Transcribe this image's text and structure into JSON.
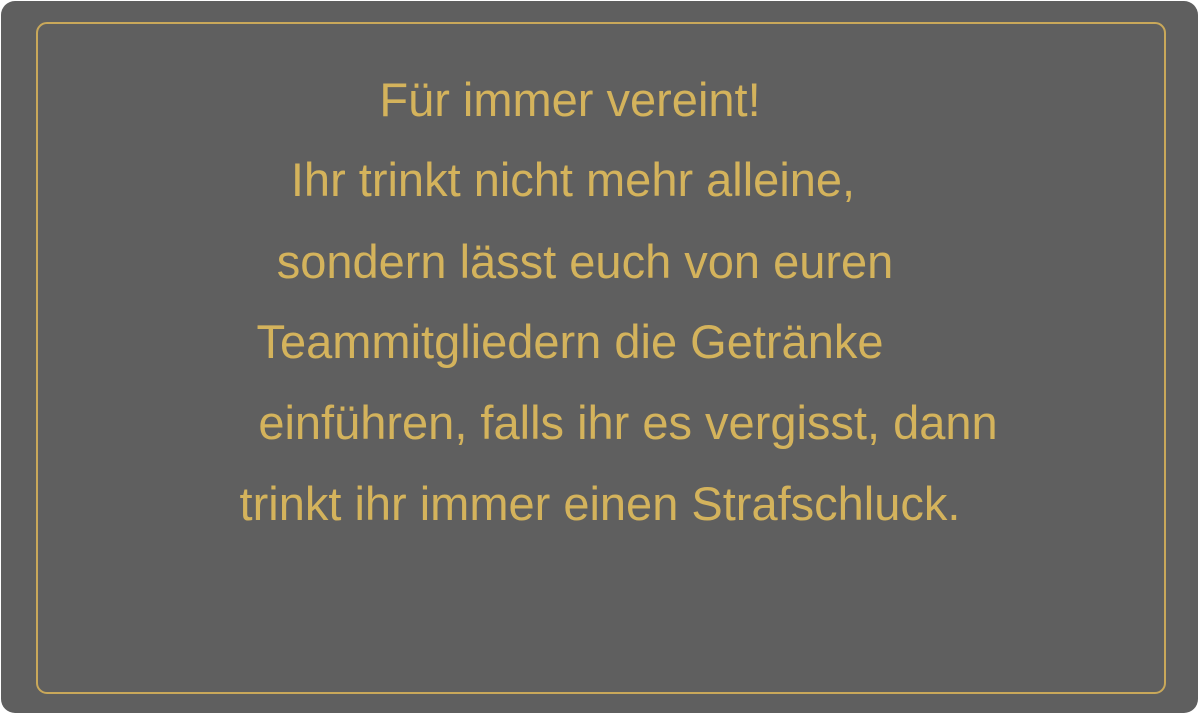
{
  "colors": {
    "background": "#5f5f5f",
    "accent": "#d4b35c",
    "border": "#c9a85a"
  },
  "card": {
    "lines": [
      "Für immer vereint!",
      "Ihr trinkt nicht mehr alleine,",
      "sondern lässt euch von euren",
      "Teammitgliedern die Getränke",
      "einführen, falls ihr es vergisst, dann",
      "trinkt ihr immer einen Strafschluck."
    ]
  }
}
